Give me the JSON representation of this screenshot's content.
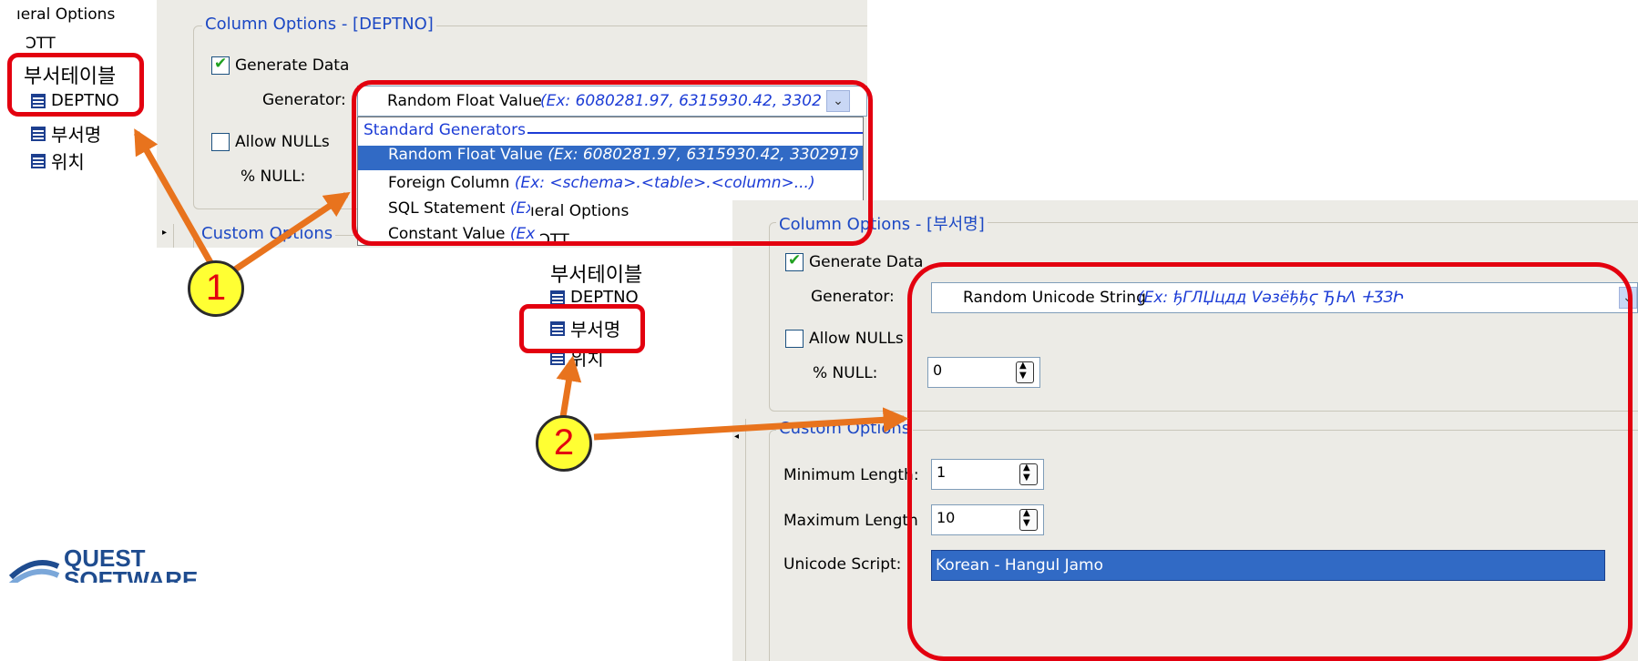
{
  "tree_top": {
    "general_options_label": "ıeral Options",
    "truncated_label": "ϽΤΤ",
    "table_label": "부서테이블",
    "columns": [
      "DEPTNO",
      "부서명",
      "위치"
    ]
  },
  "panel1": {
    "group_title": "Column Options - [DEPTNO]",
    "generate_data_label": "Generate Data",
    "generate_data_checked": true,
    "generator_label": "Generator:",
    "generator_value": "Random Float Value",
    "generator_example": "(Ex: 6080281.97, 6315930.42, 3302",
    "allow_nulls_label": "Allow NULLs",
    "allow_nulls_checked": false,
    "null_percent_label": "% NULL:",
    "custom_options_label": "Custom Options",
    "dropdown": {
      "header": "Standard Generators",
      "items": [
        {
          "name": "Random Float Value",
          "example": "(Ex: 6080281.97, 6315930.42, 3302919"
        },
        {
          "name": "Foreign Column",
          "example": "(Ex: <schema>.<table>.<column>...)"
        },
        {
          "name": "SQL Statement",
          "example": "(Ex"
        },
        {
          "name": "Constant Value",
          "example": "(Ex"
        }
      ]
    }
  },
  "tree_bottom": {
    "general_options_label": "ıeral Options",
    "truncated_label": "ϽΤΤ",
    "table_label": "부서테이블",
    "columns": [
      "DEPTNO",
      "부서명",
      "위치"
    ]
  },
  "panel2": {
    "group_title": "Column Options - [부서명]",
    "generate_data_label": "Generate Data",
    "generate_data_checked": true,
    "generator_label": "Generator:",
    "generator_value": "Random Unicode String",
    "generator_example": "(Ex: ђГЛЏцдд Vəзёђђϛ ЂҺΛ ⵜӠЗԻ",
    "allow_nulls_label": "Allow NULLs",
    "allow_nulls_checked": false,
    "null_percent_label": "% NULL:",
    "null_percent_value": "0",
    "custom_options_label": "Custom Options",
    "min_length_label": "Minimum Length:",
    "min_length_value": "1",
    "max_length_label": "Maximum Length",
    "max_length_value": "10",
    "unicode_script_label": "Unicode Script:",
    "unicode_script_value": "Korean - Hangul Jamo"
  },
  "callouts": [
    "1",
    "2"
  ],
  "logo": {
    "line1": "QUEST",
    "line2": "SOFTWARE"
  },
  "colors": {
    "callout_red": "#e3000f",
    "arrow_orange": "#e8731d",
    "badge_yellow": "#ffff33",
    "selection_blue": "#316ac5",
    "legend_blue": "#1c48c4"
  }
}
